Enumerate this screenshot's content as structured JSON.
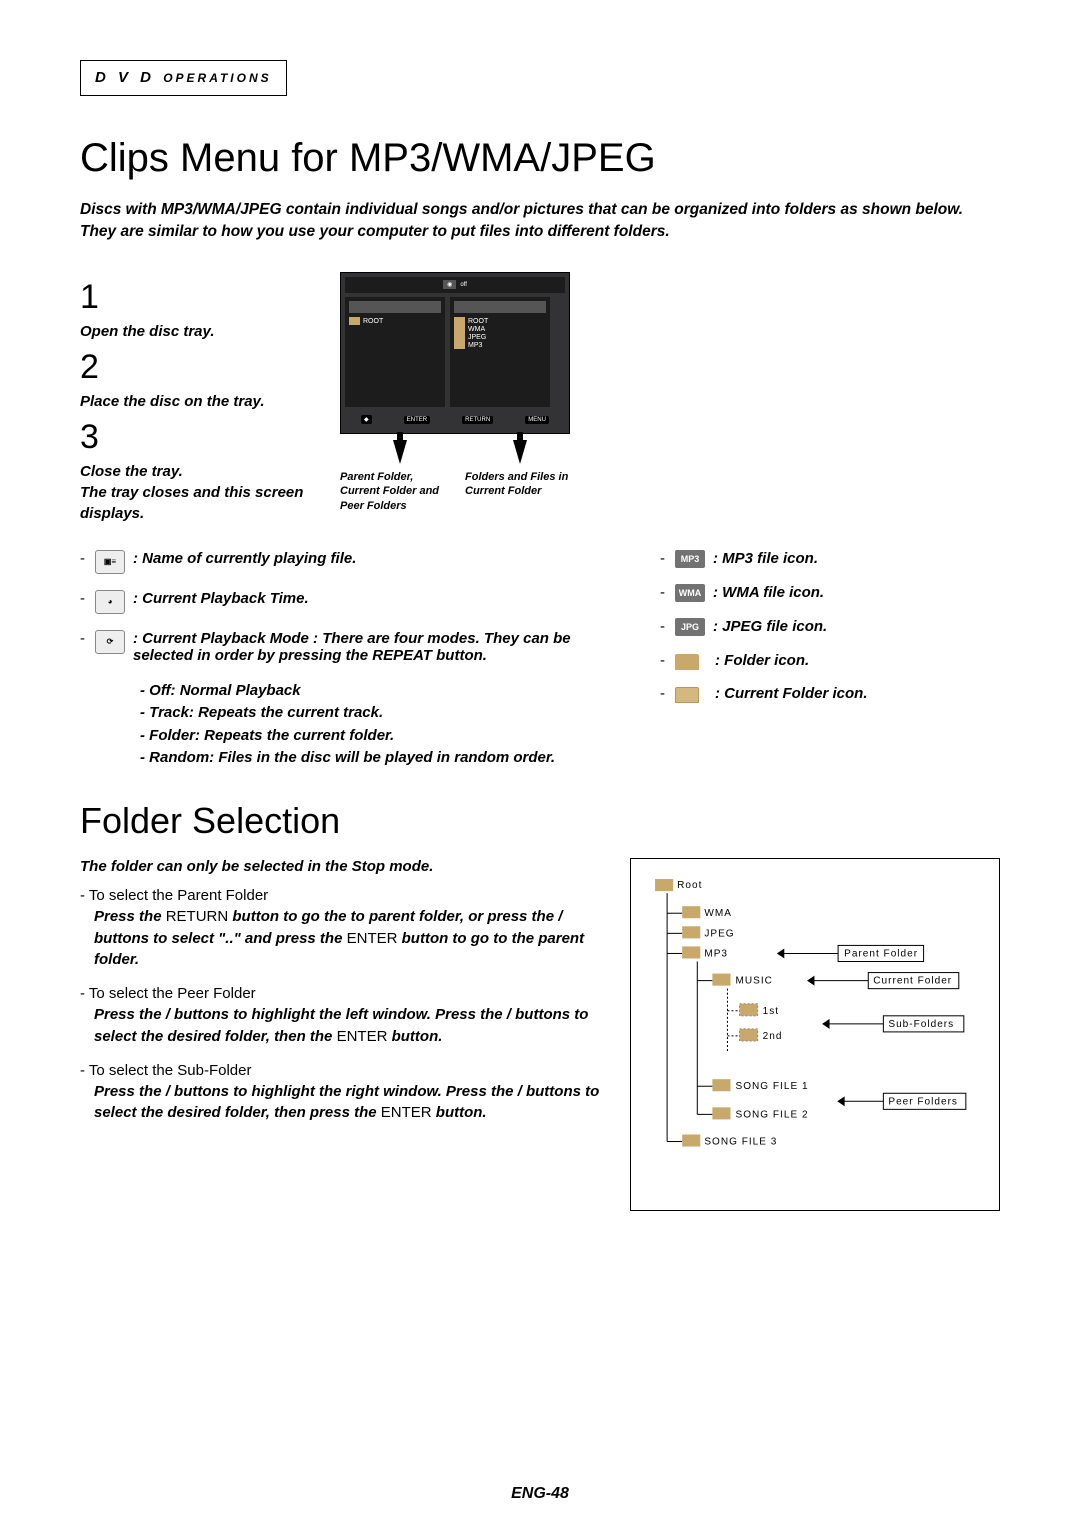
{
  "header": {
    "main": "D V D",
    "sub": "OPERATIONS"
  },
  "title": "Clips Menu for MP3/WMA/JPEG",
  "intro": "Discs with MP3/WMA/JPEG contain individual songs and/or pictures that can be organized into folders as shown below.  They are similar to how you use your computer to put files into different folders.",
  "steps": {
    "s1": {
      "num": "1",
      "desc": "Open the disc tray."
    },
    "s2": {
      "num": "2",
      "desc": "Place the disc on the tray."
    },
    "s3": {
      "num": "3",
      "desc": "Close the tray.\nThe tray closes and this screen displays."
    }
  },
  "screen": {
    "off": "off",
    "root": "ROOT",
    "wma": "WMA",
    "jpeg": "JPEG",
    "mp3": "MP3",
    "enter": "ENTER",
    "return": "RETURN",
    "menu": "MENU",
    "caption_left": "Parent Folder, Current Folder and Peer Folders",
    "caption_right": "Folders and Files in Current Folder"
  },
  "legend": {
    "l1": ":  Name of currently playing file.",
    "l2": ":  Current Playback Time.",
    "l3": ": Current Playback Mode : There are four modes. They can be selected in order by pressing the REPEAT button.",
    "l3a": "Off: Normal Playback",
    "l3b": "Track: Repeats the current track.",
    "l3c": "Folder: Repeats the current folder.",
    "l3d": "Random: Files in the disc will be played in random order.",
    "r1": ": MP3 file icon.",
    "r2": ": WMA file icon.",
    "r3": ": JPEG file icon.",
    "r4": ": Folder icon.",
    "r5": ": Current Folder icon.",
    "mp3": "MP3",
    "wma": "WMA",
    "jpg": "JPG"
  },
  "section2": {
    "title": "Folder Selection",
    "note": "The folder can only be selected in the Stop mode.",
    "g1_title": "To select the Parent Folder",
    "g1_body_a": "Press the",
    "g1_body_b": "RETURN",
    "g1_body_c": "button to go the to parent folder, or press the     /     buttons to select \"..\" and press the",
    "g1_body_d": "ENTER",
    "g1_body_e": "button to go to the parent folder.",
    "g2_title": "To select the Peer Folder",
    "g2_body": "Press the     /     buttons to highlight the left window. Press the     /     buttons to select the desired folder, then the",
    "g2_body_b": "ENTER",
    "g2_body_c": "button.",
    "g3_title": "To select the Sub-Folder",
    "g3_body": "Press the     /     buttons to highlight the right window. Press the     /     buttons to select the desired folder, then press the",
    "g3_body_b": "ENTER",
    "g3_body_c": "button."
  },
  "tree": {
    "root": "Root",
    "wma": "WMA",
    "jpeg": "JPEG",
    "mp3": "MP3",
    "music": "MUSIC",
    "first": "1st",
    "second": "2nd",
    "sf1": "SONG FILE 1",
    "sf2": "SONG FILE 2",
    "sf3": "SONG FILE 3",
    "lbl_parent": "Parent Folder",
    "lbl_current": "Current Folder",
    "lbl_sub": "Sub-Folders",
    "lbl_peer": "Peer Folders"
  },
  "page_num": "ENG-48"
}
